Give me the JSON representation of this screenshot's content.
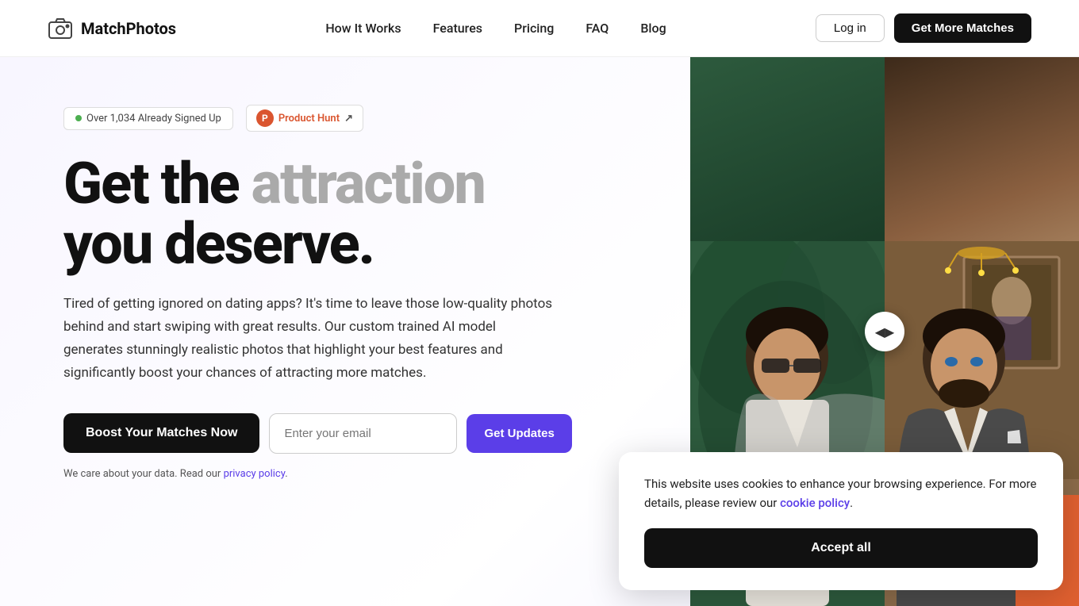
{
  "nav": {
    "logo_text": "MatchPhotos",
    "links": [
      {
        "label": "How It Works",
        "href": "#"
      },
      {
        "label": "Features",
        "href": "#"
      },
      {
        "label": "Pricing",
        "href": "#"
      },
      {
        "label": "FAQ",
        "href": "#"
      },
      {
        "label": "Blog",
        "href": "#"
      }
    ],
    "login_label": "Log in",
    "cta_label": "Get More Matches"
  },
  "hero": {
    "badge_signup": "Over 1,034 Already Signed Up",
    "badge_ph_label": "Product Hunt",
    "headline_part1": "Get the ",
    "headline_accent": "attraction",
    "headline_part2": "you deserve.",
    "subtext": "Tired of getting ignored on dating apps? It's time to leave those low-quality photos behind and start swiping with great results. Our custom trained AI model generates stunningly realistic photos that highlight your best features and significantly boost your chances of attracting more matches.",
    "boost_btn": "Boost Your Matches Now",
    "email_placeholder": "Enter your email",
    "updates_btn": "Get Updates",
    "privacy_text": "We care about your data. Read our ",
    "privacy_link": "privacy policy",
    "privacy_end": "."
  },
  "cookie": {
    "message": "This website uses cookies to enhance your browsing experience. For more details, please review our ",
    "link_text": "cookie policy",
    "link_end": ".",
    "accept_label": "Accept all"
  },
  "colors": {
    "accent_purple": "#5b3ee8",
    "accent_orange": "#e06030",
    "dark": "#111111",
    "ph_red": "#da552f"
  }
}
